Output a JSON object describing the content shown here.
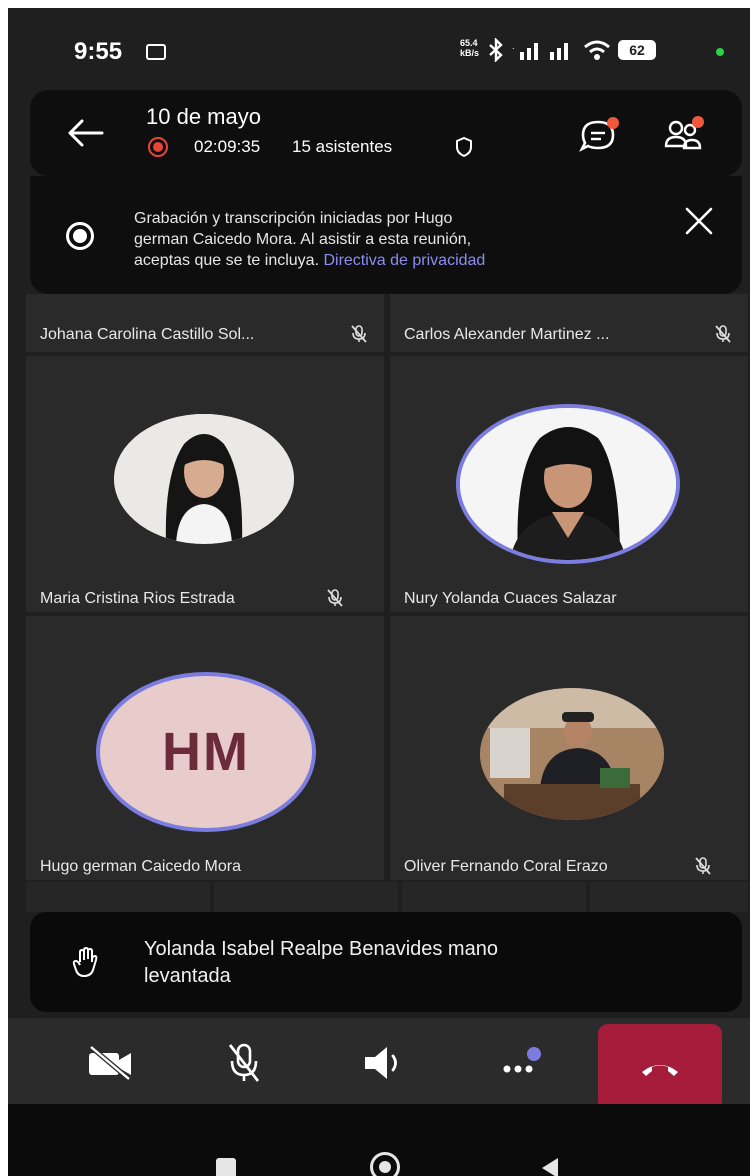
{
  "status": {
    "time": "9:55",
    "net_speed_top": "65.4",
    "net_speed_bottom": "kB/s",
    "battery": "62"
  },
  "header": {
    "title": "10 de mayo",
    "duration": "02:09:35",
    "attendees": "15 asistentes"
  },
  "banner": {
    "line1": "Grabación y transcripción iniciadas por Hugo",
    "line2": "german Caicedo Mora. Al asistir a esta reunión,",
    "line3_text": "aceptas que se te incluya.",
    "link": "Directiva de privacidad"
  },
  "participants": [
    {
      "name": "Johana Carolina Castillo Sol...",
      "muted": true
    },
    {
      "name": "Carlos Alexander Martinez ...",
      "muted": true
    },
    {
      "name": "Maria Cristina Rios Estrada",
      "muted": true
    },
    {
      "name": "Nury Yolanda Cuaces Salazar",
      "muted": false,
      "speaking": true
    },
    {
      "name": "Hugo german Caicedo Mora",
      "muted": false,
      "initials": "HM"
    },
    {
      "name": "Oliver Fernando Coral Erazo",
      "muted": true
    }
  ],
  "notification": {
    "line1": "Yolanda Isabel Realpe Benavides mano",
    "line2": "levantada"
  },
  "colors": {
    "accent": "#7b7ce0",
    "hangup": "#a61d3c",
    "badge": "#f0583c",
    "record": "#e8443a"
  }
}
